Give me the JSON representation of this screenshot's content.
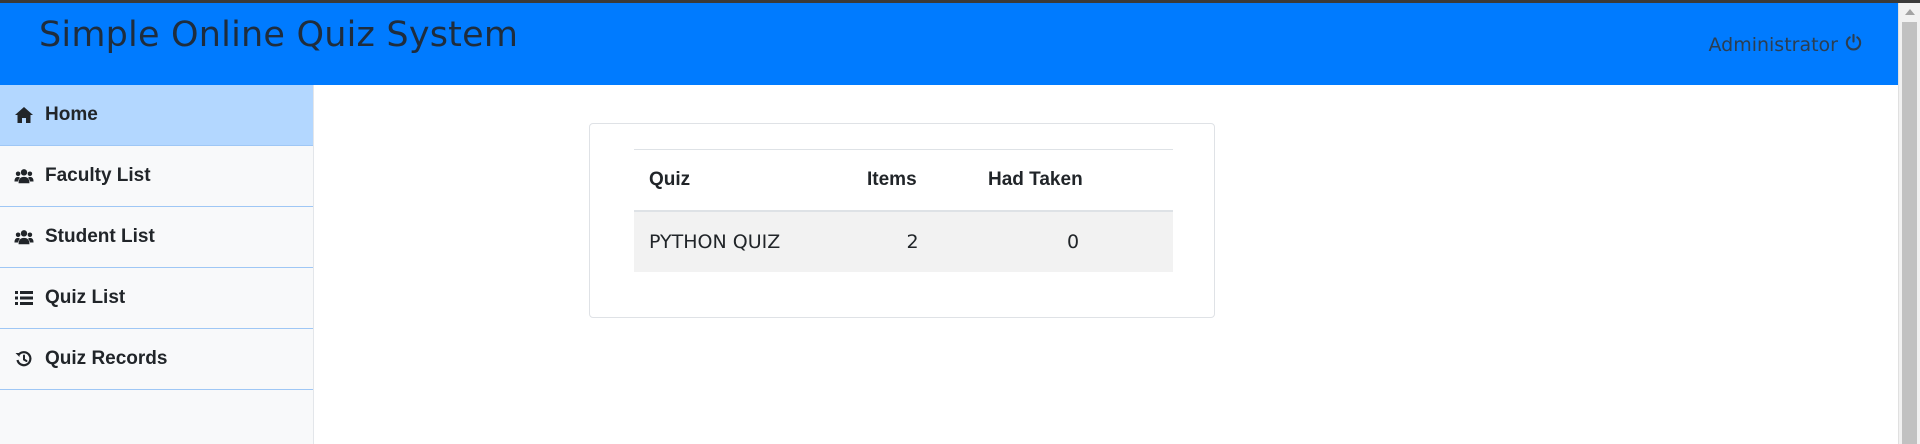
{
  "app": {
    "title": "Simple Online Quiz System",
    "user": "Administrator"
  },
  "sidebar": {
    "items": [
      {
        "label": "Home",
        "icon": "home-icon",
        "active": true
      },
      {
        "label": "Faculty List",
        "icon": "users-icon",
        "active": false
      },
      {
        "label": "Student List",
        "icon": "users-icon",
        "active": false
      },
      {
        "label": "Quiz List",
        "icon": "list-icon",
        "active": false
      },
      {
        "label": "Quiz Records",
        "icon": "history-icon",
        "active": false
      }
    ]
  },
  "table": {
    "headers": [
      "Quiz",
      "Items",
      "Had Taken"
    ],
    "rows": [
      {
        "quiz": "PYTHON QUIZ",
        "items": "2",
        "taken": "0"
      }
    ]
  },
  "colors": {
    "navbar": "#007bff",
    "sidebar_active": "#b3d7ff",
    "sidebar_border": "#9fc7f5"
  }
}
